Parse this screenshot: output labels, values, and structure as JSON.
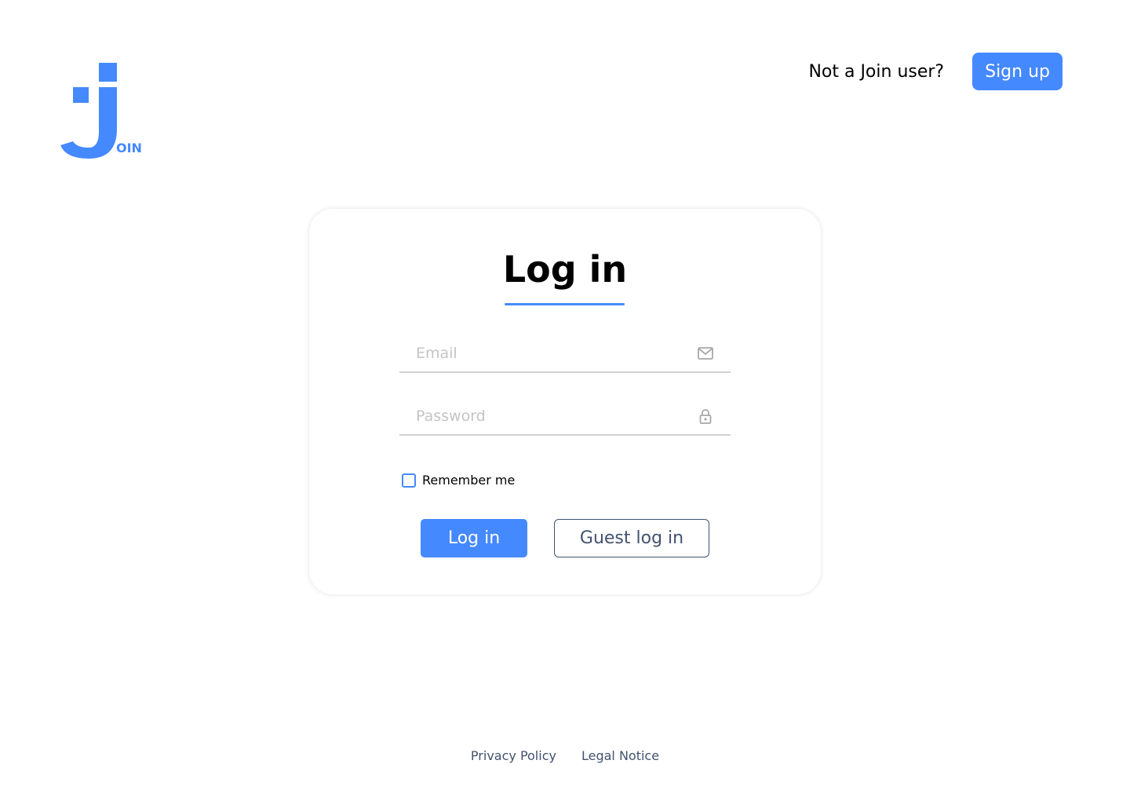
{
  "brand": {
    "logo_text": "OIN",
    "color": "#4589ff"
  },
  "header": {
    "signup_question": "Not a Join user?",
    "signup_label": "Sign up"
  },
  "login": {
    "title": "Log in",
    "email_placeholder": "Email",
    "email_value": "",
    "email_icon": "envelope-icon",
    "password_placeholder": "Password",
    "password_value": "",
    "password_icon": "lock-icon",
    "remember_label": "Remember me",
    "remember_checked": false,
    "login_label": "Log in",
    "guest_label": "Guest log in"
  },
  "footer": {
    "links": [
      "Privacy Policy",
      "Legal Notice"
    ]
  },
  "colors": {
    "accent": "#4589ff",
    "text_dark": "#000000",
    "text_muted": "#42526e",
    "divider": "#d1d1d1"
  }
}
